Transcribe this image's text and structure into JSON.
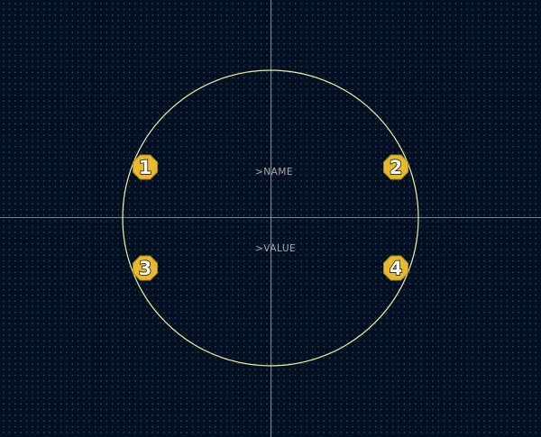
{
  "editor": {
    "name_placeholder": ">NAME",
    "value_placeholder": ">VALUE"
  },
  "pads": [
    {
      "label": "1"
    },
    {
      "label": "2"
    },
    {
      "label": "3"
    },
    {
      "label": "4"
    }
  ],
  "colors": {
    "background": "#001023",
    "grid_dot": "#7887a0",
    "crosshair": "#c8c8c8",
    "outline": "#f2eda1",
    "pad_fill": "#e8b92a",
    "pad_stroke": "#a88318",
    "placeholder_text": "#a8a8a8"
  }
}
